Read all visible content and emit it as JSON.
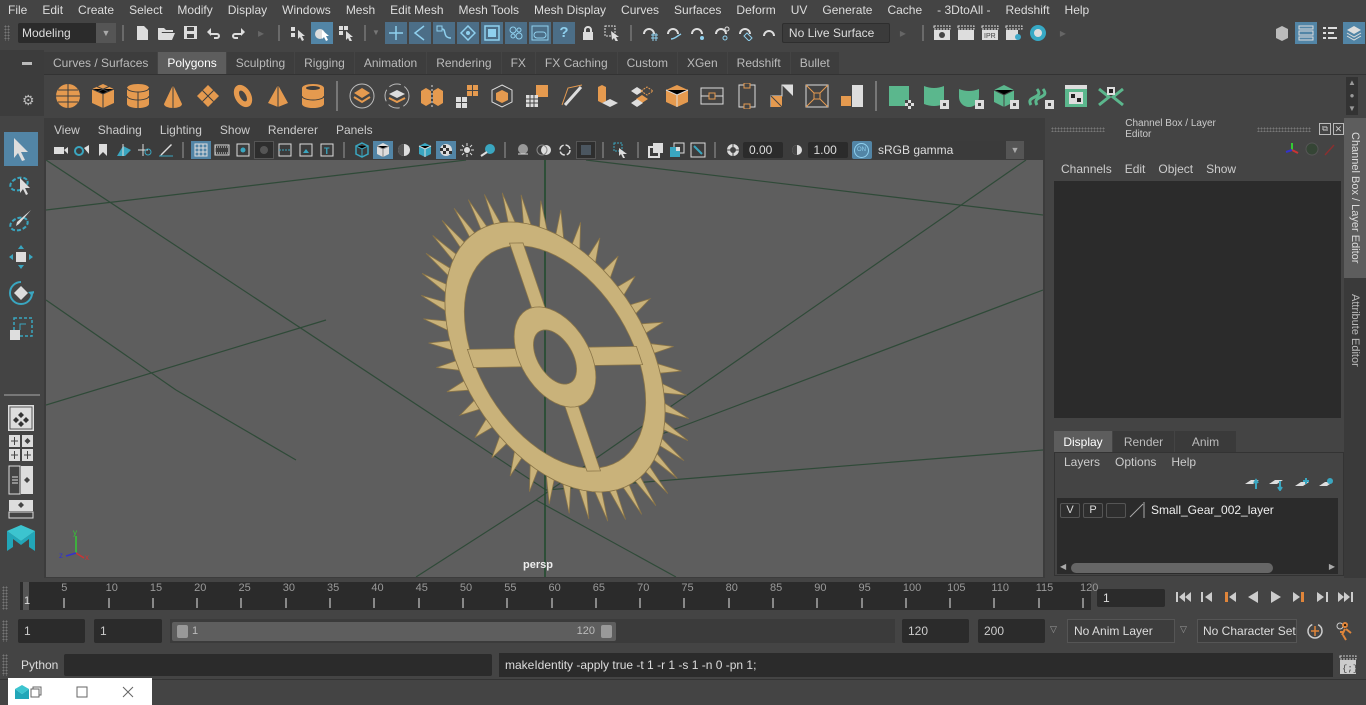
{
  "menubar": {
    "items": [
      "File",
      "Edit",
      "Create",
      "Select",
      "Modify",
      "Display",
      "Windows",
      "Mesh",
      "Edit Mesh",
      "Mesh Tools",
      "Mesh Display",
      "Curves",
      "Surfaces",
      "Deform",
      "UV",
      "Generate",
      "Cache",
      "- 3DtoAll -",
      "Redshift",
      "Help"
    ]
  },
  "statusline": {
    "menuset": "Modeling",
    "live_surface": "No Live Surface"
  },
  "shelf": {
    "tabs": [
      "Curves / Surfaces",
      "Polygons",
      "Sculpting",
      "Rigging",
      "Animation",
      "Rendering",
      "FX",
      "FX Caching",
      "Custom",
      "XGen",
      "Redshift",
      "Bullet"
    ],
    "active_tab": "Polygons",
    "colors": {
      "orange": "#e59a4f",
      "green": "#5bb78d",
      "accent": "#5285a6"
    }
  },
  "viewport": {
    "menu": [
      "View",
      "Shading",
      "Lighting",
      "Show",
      "Renderer",
      "Panels"
    ],
    "exposure": "0.00",
    "gamma": "1.00",
    "color_space": "sRGB gamma",
    "color_mgmt_badge": "ON",
    "camera_label": "persp",
    "axis": {
      "x": "x",
      "y": "y",
      "z": "z"
    },
    "object": "Small_Gear_002"
  },
  "channel_box": {
    "title": "Channel Box / Layer Editor",
    "menu": [
      "Channels",
      "Edit",
      "Object",
      "Show"
    ]
  },
  "layer_editor": {
    "tabs": [
      "Display",
      "Render",
      "Anim"
    ],
    "active_tab": "Display",
    "menu": [
      "Layers",
      "Options",
      "Help"
    ],
    "layers": [
      {
        "v": "V",
        "p": "P",
        "name": "Small_Gear_002_layer"
      }
    ]
  },
  "side_tabs": [
    "Channel Box / Layer Editor",
    "Attribute Editor"
  ],
  "timeline": {
    "start_marker": "1",
    "ticks": [
      5,
      10,
      15,
      20,
      25,
      30,
      35,
      40,
      45,
      50,
      55,
      60,
      65,
      70,
      75,
      80,
      85,
      90,
      95,
      100,
      105,
      110,
      115,
      120
    ],
    "current_frame": "1"
  },
  "range": {
    "start": "1",
    "playback_start": "1",
    "slider_min": "1",
    "slider_max": "120",
    "playback_end": "120",
    "end": "200",
    "anim_layer": "No Anim Layer",
    "character_set": "No Character Set"
  },
  "command": {
    "language": "Python",
    "input": "",
    "last_output": "makeIdentity -apply true -t 1 -r 1 -s 1 -n 0 -pn 1;"
  }
}
